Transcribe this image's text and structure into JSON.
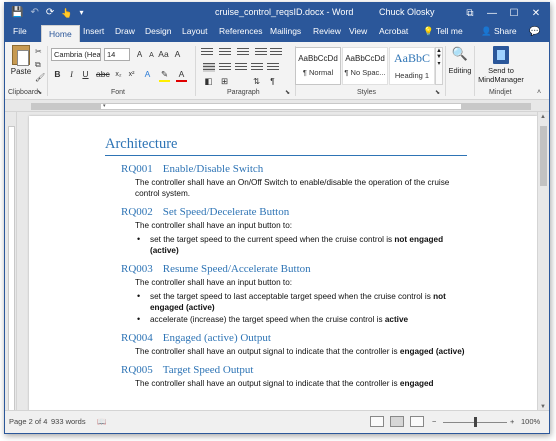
{
  "title_bar": {
    "doc_title": "cruise_control_reqsID.docx - Word",
    "user_name": "Chuck Olosky",
    "qat": [
      "save-icon",
      "undo-icon",
      "redo-icon",
      "touch-mode-icon",
      "customize-icon"
    ],
    "qat_glyphs": [
      "💾",
      "↶",
      "⟳",
      "👆",
      "▾"
    ],
    "window_controls": [
      "⧉",
      "—",
      "☐",
      "✕"
    ]
  },
  "tabs": {
    "items": [
      "File",
      "Home",
      "Insert",
      "Draw",
      "Design",
      "Layout",
      "References",
      "Mailings",
      "Review",
      "View",
      "Acrobat"
    ],
    "active": "Home",
    "tell_me": "Tell me",
    "share": "Share"
  },
  "ribbon": {
    "clipboard": {
      "paste_label": "Paste",
      "group_label": "Clipboard"
    },
    "font": {
      "font_name": "Cambria (Hea",
      "font_size": "14",
      "group_label": "Font"
    },
    "paragraph": {
      "group_label": "Paragraph"
    },
    "styles": {
      "group_label": "Styles",
      "cards": [
        {
          "sample": "AaBbCcDd",
          "name": "¶ Normal"
        },
        {
          "sample": "AaBbCcDd",
          "name": "¶ No Spac..."
        },
        {
          "sample": "AaBbC",
          "name": "Heading 1"
        }
      ]
    },
    "editing": {
      "label": "Editing"
    },
    "mindjet": {
      "label_line1": "Send to",
      "label_line2": "MindManager",
      "group_label": "Mindjet"
    }
  },
  "document": {
    "heading": "Architecture",
    "requirements": [
      {
        "id": "RQ001",
        "title": "Enable/Disable Switch",
        "body": "The controller shall have an On/Off Switch to enable/disable the operation of the cruise control system."
      },
      {
        "id": "RQ002",
        "title": "Set Speed/Decelerate Button",
        "body": "The controller shall have an input button to:",
        "bullets": [
          {
            "text": "set the target speed to the current speed when the cruise control is ",
            "bold": "not engaged (active)"
          }
        ]
      },
      {
        "id": "RQ003",
        "title": "Resume Speed/Accelerate Button",
        "body": "The controller shall have an input button to:",
        "bullets": [
          {
            "text": "set the target speed to last acceptable target speed when the cruise control is ",
            "bold": "not engaged (active)"
          },
          {
            "text": "accelerate (increase) the target speed when the cruise control is ",
            "bold": "active"
          }
        ]
      },
      {
        "id": "RQ004",
        "title": "Engaged (active) Output",
        "body_text": "The controller shall have an output signal to indicate that the controller is ",
        "body_bold": "engaged (active)"
      },
      {
        "id": "RQ005",
        "title": "Target Speed Output",
        "body_text": "The controller shall have an output signal to indicate that the controller is ",
        "body_bold": "engaged"
      }
    ]
  },
  "status_bar": {
    "page": "Page 2 of 4",
    "words": "933 words",
    "zoom": "100%",
    "zoom_out": "−",
    "zoom_in": "+",
    "zoom_fraction": 0.5
  }
}
